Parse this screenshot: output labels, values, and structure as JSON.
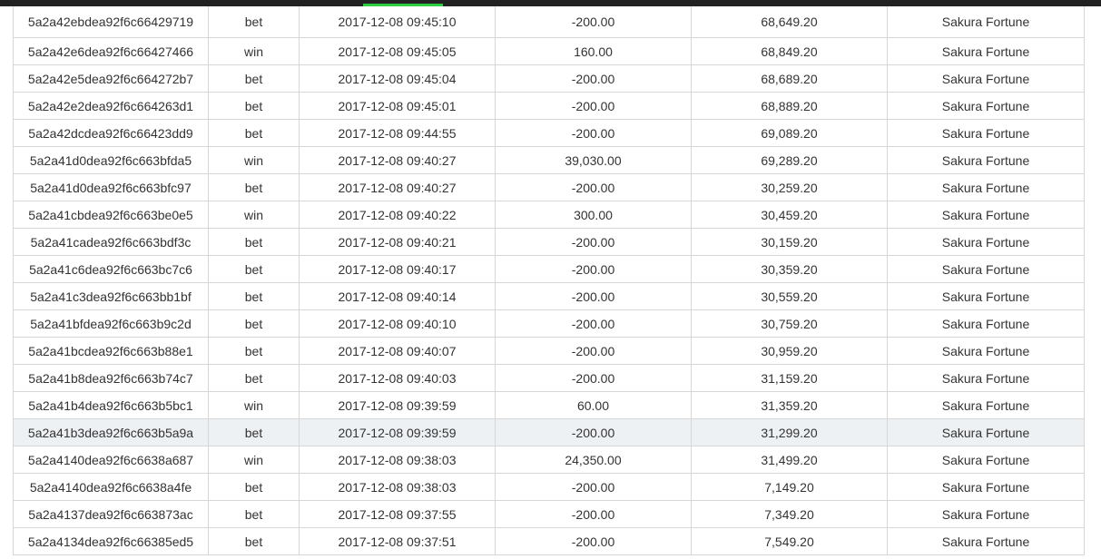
{
  "colors": {
    "topbar": "#222222",
    "accent": "#2ecc40",
    "highlight_row": "#eef1f4",
    "border": "#d6d6d6"
  },
  "rows": [
    {
      "id": "5a2a42ebdea92f6c66429719",
      "type": "bet",
      "time": "2017-12-08 09:45:10",
      "amount": "-200.00",
      "balance": "68,649.20",
      "game": "Sakura Fortune"
    },
    {
      "id": "5a2a42e6dea92f6c66427466",
      "type": "win",
      "time": "2017-12-08 09:45:05",
      "amount": "160.00",
      "balance": "68,849.20",
      "game": "Sakura Fortune"
    },
    {
      "id": "5a2a42e5dea92f6c664272b7",
      "type": "bet",
      "time": "2017-12-08 09:45:04",
      "amount": "-200.00",
      "balance": "68,689.20",
      "game": "Sakura Fortune"
    },
    {
      "id": "5a2a42e2dea92f6c664263d1",
      "type": "bet",
      "time": "2017-12-08 09:45:01",
      "amount": "-200.00",
      "balance": "68,889.20",
      "game": "Sakura Fortune"
    },
    {
      "id": "5a2a42dcdea92f6c66423dd9",
      "type": "bet",
      "time": "2017-12-08 09:44:55",
      "amount": "-200.00",
      "balance": "69,089.20",
      "game": "Sakura Fortune"
    },
    {
      "id": "5a2a41d0dea92f6c663bfda5",
      "type": "win",
      "time": "2017-12-08 09:40:27",
      "amount": "39,030.00",
      "balance": "69,289.20",
      "game": "Sakura Fortune"
    },
    {
      "id": "5a2a41d0dea92f6c663bfc97",
      "type": "bet",
      "time": "2017-12-08 09:40:27",
      "amount": "-200.00",
      "balance": "30,259.20",
      "game": "Sakura Fortune"
    },
    {
      "id": "5a2a41cbdea92f6c663be0e5",
      "type": "win",
      "time": "2017-12-08 09:40:22",
      "amount": "300.00",
      "balance": "30,459.20",
      "game": "Sakura Fortune"
    },
    {
      "id": "5a2a41cadea92f6c663bdf3c",
      "type": "bet",
      "time": "2017-12-08 09:40:21",
      "amount": "-200.00",
      "balance": "30,159.20",
      "game": "Sakura Fortune"
    },
    {
      "id": "5a2a41c6dea92f6c663bc7c6",
      "type": "bet",
      "time": "2017-12-08 09:40:17",
      "amount": "-200.00",
      "balance": "30,359.20",
      "game": "Sakura Fortune"
    },
    {
      "id": "5a2a41c3dea92f6c663bb1bf",
      "type": "bet",
      "time": "2017-12-08 09:40:14",
      "amount": "-200.00",
      "balance": "30,559.20",
      "game": "Sakura Fortune"
    },
    {
      "id": "5a2a41bfdea92f6c663b9c2d",
      "type": "bet",
      "time": "2017-12-08 09:40:10",
      "amount": "-200.00",
      "balance": "30,759.20",
      "game": "Sakura Fortune"
    },
    {
      "id": "5a2a41bcdea92f6c663b88e1",
      "type": "bet",
      "time": "2017-12-08 09:40:07",
      "amount": "-200.00",
      "balance": "30,959.20",
      "game": "Sakura Fortune"
    },
    {
      "id": "5a2a41b8dea92f6c663b74c7",
      "type": "bet",
      "time": "2017-12-08 09:40:03",
      "amount": "-200.00",
      "balance": "31,159.20",
      "game": "Sakura Fortune"
    },
    {
      "id": "5a2a41b4dea92f6c663b5bc1",
      "type": "win",
      "time": "2017-12-08 09:39:59",
      "amount": "60.00",
      "balance": "31,359.20",
      "game": "Sakura Fortune"
    },
    {
      "id": "5a2a41b3dea92f6c663b5a9a",
      "type": "bet",
      "time": "2017-12-08 09:39:59",
      "amount": "-200.00",
      "balance": "31,299.20",
      "game": "Sakura Fortune",
      "highlighted": true
    },
    {
      "id": "5a2a4140dea92f6c6638a687",
      "type": "win",
      "time": "2017-12-08 09:38:03",
      "amount": "24,350.00",
      "balance": "31,499.20",
      "game": "Sakura Fortune"
    },
    {
      "id": "5a2a4140dea92f6c6638a4fe",
      "type": "bet",
      "time": "2017-12-08 09:38:03",
      "amount": "-200.00",
      "balance": "7,149.20",
      "game": "Sakura Fortune"
    },
    {
      "id": "5a2a4137dea92f6c663873ac",
      "type": "bet",
      "time": "2017-12-08 09:37:55",
      "amount": "-200.00",
      "balance": "7,349.20",
      "game": "Sakura Fortune"
    },
    {
      "id": "5a2a4134dea92f6c66385ed5",
      "type": "bet",
      "time": "2017-12-08 09:37:51",
      "amount": "-200.00",
      "balance": "7,549.20",
      "game": "Sakura Fortune"
    }
  ]
}
